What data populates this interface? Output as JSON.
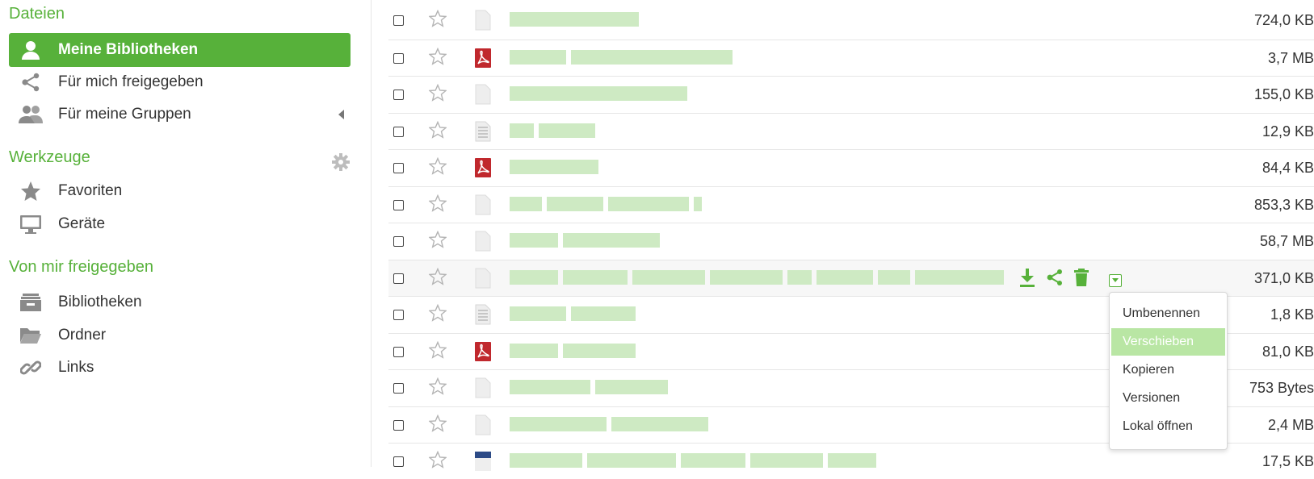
{
  "sidebar": {
    "files_title": "Dateien",
    "files_items": [
      {
        "label": "Meine Bibliotheken",
        "icon": "user-icon",
        "active": true
      },
      {
        "label": "Für mich freigegeben",
        "icon": "share-icon"
      },
      {
        "label": "Für meine Gruppen",
        "icon": "group-icon"
      }
    ],
    "tools_title": "Werkzeuge",
    "tools_items": [
      {
        "label": "Favoriten",
        "icon": "star-icon"
      },
      {
        "label": "Geräte",
        "icon": "monitor-icon"
      }
    ],
    "shared_title": "Von mir freigegeben",
    "shared_items": [
      {
        "label": "Bibliotheken",
        "icon": "library-icon"
      },
      {
        "label": "Ordner",
        "icon": "folder-icon"
      },
      {
        "label": "Links",
        "icon": "link-icon"
      }
    ]
  },
  "files": [
    {
      "type": "file",
      "size": "724,0 KB"
    },
    {
      "type": "pdf",
      "size": "3,7 MB"
    },
    {
      "type": "file",
      "size": "155,0 KB"
    },
    {
      "type": "text",
      "size": "12,9 KB"
    },
    {
      "type": "pdf",
      "size": "84,4 KB"
    },
    {
      "type": "file",
      "size": "853,3 KB"
    },
    {
      "type": "file",
      "size": "58,7 MB"
    },
    {
      "type": "file",
      "size": "371,0 KB",
      "hovered": true
    },
    {
      "type": "text",
      "size": "1,8 KB"
    },
    {
      "type": "pdf",
      "size": "81,0 KB"
    },
    {
      "type": "file",
      "size": "753 Bytes"
    },
    {
      "type": "file",
      "size": "2,4 MB"
    },
    {
      "type": "doc",
      "size": "17,5 KB"
    }
  ],
  "row_operations": [
    "download-icon",
    "share-icon",
    "delete-icon",
    "more-dropdown-icon"
  ],
  "dropdown_menu": {
    "items": [
      "Umbenennen",
      "Verschieben",
      "Kopieren",
      "Versionen",
      "Lokal öffnen"
    ],
    "highlighted": "Verschieben"
  },
  "colors": {
    "accent": "#57b13a",
    "menu_highlight": "#b9e6a4",
    "pdf": "#c0282d",
    "doc": "#2c4a86"
  }
}
